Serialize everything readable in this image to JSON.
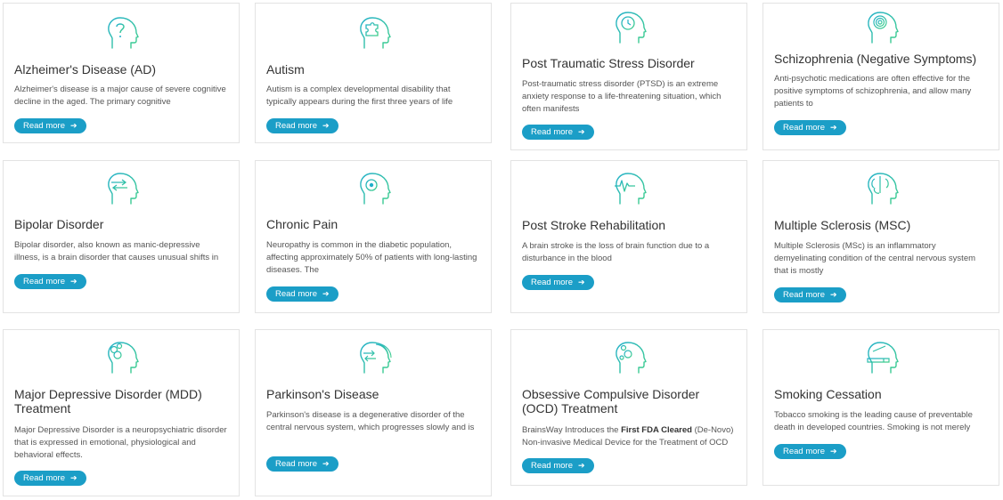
{
  "accent_color": "#1b9ec7",
  "read_more_label": "Read more",
  "cards": [
    {
      "title": "Alzheimer's Disease (AD)",
      "icon": "head-question-icon",
      "desc": "Alzheimer's disease is a major cause of severe cognitive decline in the aged. The primary cognitive"
    },
    {
      "title": "Autism",
      "icon": "head-puzzle-icon",
      "desc": "Autism is a complex developmental disability that typically appears during the first three years of life"
    },
    {
      "title": "Post Traumatic Stress Disorder",
      "icon": "head-clock-icon",
      "desc": "Post-traumatic stress disorder (PTSD) is an extreme anxiety response to a life-threatening situation, which often manifests"
    },
    {
      "title": "Schizophrenia (Negative Symptoms)",
      "icon": "head-spiral-icon",
      "desc": "Anti-psychotic medications are often effective for the positive symptoms of schizophrenia, and allow many patients to"
    },
    {
      "title": "Bipolar Disorder",
      "icon": "head-arrows-icon",
      "desc": "Bipolar disorder, also known as manic-depressive illness, is a brain disorder that causes unusual shifts in"
    },
    {
      "title": "Chronic Pain",
      "icon": "head-target-icon",
      "desc": "Neuropathy is common in the diabetic population, affecting approximately 50% of patients with long-lasting diseases. The"
    },
    {
      "title": "Post Stroke Rehabilitation",
      "icon": "head-pulse-icon",
      "desc": "A brain stroke is the loss of brain function due to a disturbance in the blood"
    },
    {
      "title": "Multiple Sclerosis (MSC)",
      "icon": "head-brain-icon",
      "desc": "Multiple Sclerosis (MSc) is an inflammatory demyelinating condition of the central nervous system that is mostly"
    },
    {
      "title": "Major Depressive Disorder (MDD) Treatment",
      "icon": "head-bubbles-icon",
      "desc": "Major Depressive Disorder is a neuropsychiatric disorder that is expressed in emotional, physiological and behavioral effects."
    },
    {
      "title": "Parkinson's Disease",
      "icon": "head-tremor-icon",
      "desc": "Parkinson's disease is a degenerative disorder of the central nervous system, which progresses slowly and is"
    },
    {
      "title": "Obsessive Compulsive Disorder (OCD) Treatment",
      "icon": "head-bubbles-2-icon",
      "desc_pre": "BrainsWay Introduces the ",
      "desc_bold": "First FDA Cleared",
      "desc_post": " (De-Novo) Non-invasive Medical Device for the Treatment of OCD"
    },
    {
      "title": "Smoking Cessation",
      "icon": "head-cigarette-icon",
      "desc": "Tobacco smoking is the leading cause of preventable death in developed countries. Smoking is not merely"
    }
  ]
}
